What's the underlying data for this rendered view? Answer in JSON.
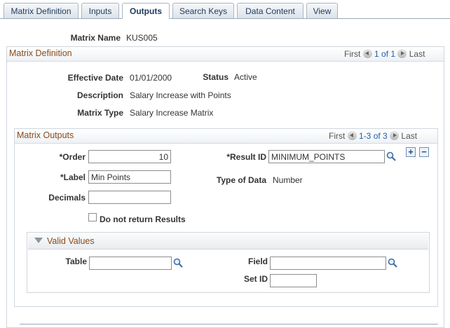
{
  "tabs": [
    {
      "label": "Matrix Definition"
    },
    {
      "label": "Inputs"
    },
    {
      "label": "Outputs"
    },
    {
      "label": "Search Keys"
    },
    {
      "label": "Data Content"
    },
    {
      "label": "View"
    }
  ],
  "matrix_name": {
    "label": "Matrix Name",
    "value": "KUS005"
  },
  "definition": {
    "title": "Matrix Definition",
    "nav": {
      "first": "First",
      "range": "1 of 1",
      "last": "Last"
    },
    "effective_date": {
      "label": "Effective Date",
      "value": "01/01/2000"
    },
    "status": {
      "label": "Status",
      "value": "Active"
    },
    "description": {
      "label": "Description",
      "value": "Salary Increase with Points"
    },
    "matrix_type": {
      "label": "Matrix Type",
      "value": "Salary Increase Matrix"
    }
  },
  "outputs": {
    "title": "Matrix Outputs",
    "nav": {
      "first": "First",
      "range": "1-3 of 3",
      "last": "Last"
    },
    "order": {
      "label": "*Order",
      "value": "10"
    },
    "result_id": {
      "label": "*Result ID",
      "value": "MINIMUM_POINTS"
    },
    "label": {
      "label": "*Label",
      "value": "Min Points"
    },
    "type_of_data": {
      "label": "Type of Data",
      "value": "Number"
    },
    "decimals": {
      "label": "Decimals",
      "value": ""
    },
    "do_not_return": {
      "label": "Do not return Results",
      "checked": false
    }
  },
  "valid_values": {
    "title": "Valid Values",
    "table": {
      "label": "Table",
      "value": ""
    },
    "field": {
      "label": "Field",
      "value": ""
    },
    "set_id": {
      "label": "Set ID",
      "value": ""
    }
  },
  "icons": {
    "lookup": "magnifier-icon",
    "add": "plus-icon",
    "remove": "minus-icon",
    "collapse": "triangle-down-icon"
  },
  "colors": {
    "group_title": "#8a4a1c",
    "link": "#1f5fa8",
    "tab_text": "#1f3a5a"
  }
}
